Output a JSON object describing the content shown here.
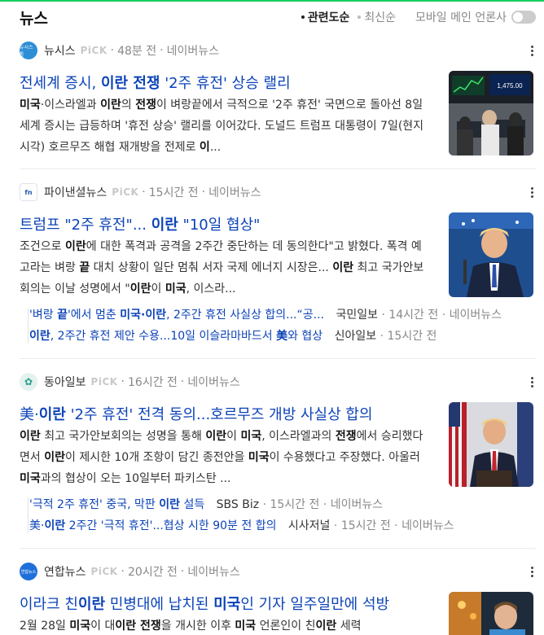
{
  "header": {
    "title": "뉴스",
    "sort_options": [
      {
        "label": "관련도순",
        "active": true
      },
      {
        "label": "최신순",
        "active": false
      }
    ],
    "mobile_toggle_label": "모바일 메인 언론사"
  },
  "articles": [
    {
      "press": "뉴시스",
      "press_logo_text": "뉴시스통",
      "press_color": "#2d8ed6",
      "pick": "PiCK",
      "time": "48분 전",
      "source": "네이버뉴스",
      "headline": "전세계 증시, 이란 전쟁 '2주 휴전' 상승 랠리",
      "snippet": "미국·이스라엘과 이란의 전쟁이 벼랑끝에서 극적으로 '2주 휴전' 국면으로 돌아선 8일 세계 증시는 급등하며 '휴전 상승' 랠리를 이어갔다. 도널드 트럼프 대통령이 7일(현지 시각) 호르무즈 해협 재개방을 전제로 이...",
      "thumb_label": "1,475.00",
      "thumb_name": "stock-market-photo"
    },
    {
      "press": "파이낸셜뉴스",
      "press_logo_text": "fn",
      "press_color": "#2359a8",
      "pick": "PiCK",
      "time": "15시간 전",
      "source": "네이버뉴스",
      "headline": "트럼프 \"2주 휴전\"... 이란 \"10일 협상\"",
      "snippet": "조건으로 이란에 대한 폭격과 공격을 2주간 중단하는 데 동의한다\"고 밝혔다. 폭격 예고라는 벼랑 끝 대치 상황이 일단 멈춰 서자 국제 에너지 시장은... 이란 최고 국가안보회의는 이날 성명에서 \"이란이 미국, 이스라...",
      "thumb_name": "trump-photo",
      "related": [
        {
          "title": "'벼랑 끝'에서 멈춘 미국·이란, 2주간 휴전 사실상 합의...\"공...",
          "press": "국민일보",
          "time": "14시간 전",
          "source": "네이버뉴스"
        },
        {
          "title": "이란, 2주간 휴전 제안 수용...10일 이슬라마바드서 美와 협상",
          "press": "신아일보",
          "time": "15시간 전",
          "source": ""
        }
      ]
    },
    {
      "press": "동아일보",
      "press_logo_text": "✿",
      "press_color": "#2a9d8f",
      "pick": "PiCK",
      "time": "16시간 전",
      "source": "네이버뉴스",
      "headline": "美·이란 '2주 휴전' 전격 동의...호르무즈 개방 사실상 합의",
      "snippet": "이란 최고 국가안보회의는 성명을 통해 이란이 미국, 이스라엘과의 전쟁에서 승리했다면서 이란이 제시한 10개 조항이 담긴 종전안을 미국이 수용했다고 주장했다. 아울러 미국과의 협상이 오는 10일부터 파키스탄 ...",
      "thumb_name": "trump-podium-photo",
      "related": [
        {
          "title": "'극적 2주 휴전' 중국, 막판 이란 설득",
          "press": "SBS Biz",
          "time": "15시간 전",
          "source": "네이버뉴스"
        },
        {
          "title": "美·이란 2주간 '극적 휴전'...협상 시한 90분 전 합의",
          "press": "시사저널",
          "time": "15시간 전",
          "source": "네이버뉴스"
        }
      ]
    },
    {
      "press": "연합뉴스",
      "press_logo_text": "연합뉴스",
      "press_color": "#1e6fd9",
      "pick": "PiCK",
      "time": "20시간 전",
      "source": "네이버뉴스",
      "headline": "이라크 친이란 민병대에 납치된 미국인 기자 일주일만에 석방",
      "snippet": "2월 28일 미국이 대이란 전쟁을 개시한 이후 미국 언론인이 친이란 세력",
      "thumb_name": "journalist-photo"
    }
  ]
}
